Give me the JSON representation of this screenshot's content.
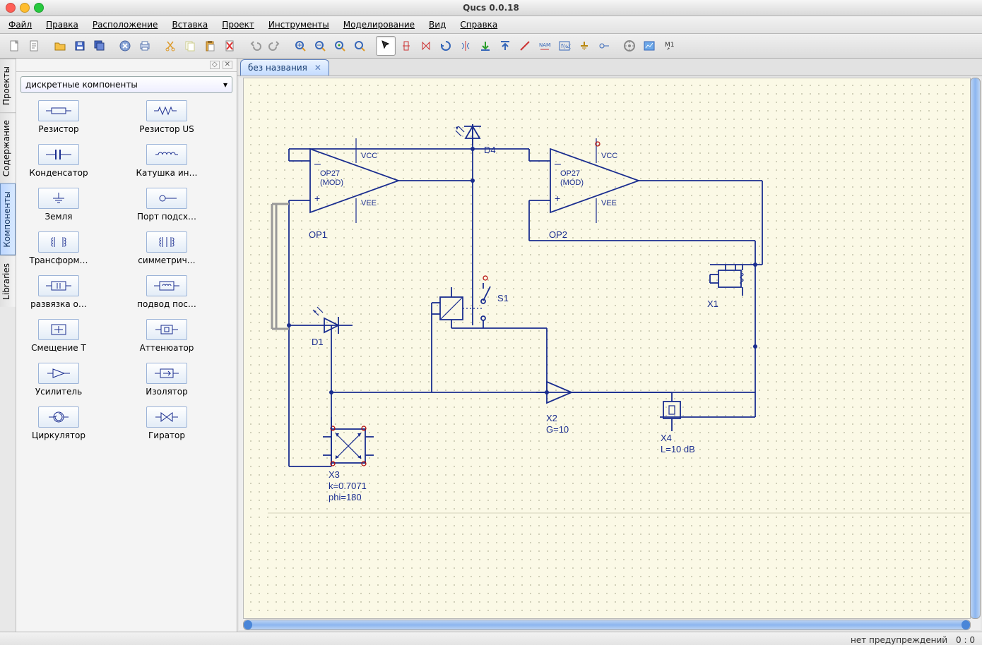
{
  "title": "Qucs 0.0.18",
  "menus": [
    "Файл",
    "Правка",
    "Расположение",
    "Вставка",
    "Проект",
    "Инструменты",
    "Моделирование",
    "Вид",
    "Справка"
  ],
  "side_tabs": [
    "Проекты",
    "Содержание",
    "Компоненты",
    "Libraries"
  ],
  "combo": "дискретные компоненты",
  "palette": [
    {
      "label": "Резистор",
      "icon": "resistor"
    },
    {
      "label": "Резистор US",
      "icon": "resistor-us"
    },
    {
      "label": "Конденсатор",
      "icon": "capacitor"
    },
    {
      "label": "Катушка ин…",
      "icon": "inductor"
    },
    {
      "label": "Земля",
      "icon": "ground"
    },
    {
      "label": "Порт подсх…",
      "icon": "port"
    },
    {
      "label": "Трансформ…",
      "icon": "transformer"
    },
    {
      "label": "симметрич…",
      "icon": "sym-transformer"
    },
    {
      "label": "развязка о…",
      "icon": "dc-block"
    },
    {
      "label": "подвод пос…",
      "icon": "dc-feed"
    },
    {
      "label": "Смещение T",
      "icon": "bias-t"
    },
    {
      "label": "Аттенюатор",
      "icon": "attenuator"
    },
    {
      "label": "Усилитель",
      "icon": "amplifier"
    },
    {
      "label": "Изолятор",
      "icon": "isolator"
    },
    {
      "label": "Циркулятор",
      "icon": "circulator"
    },
    {
      "label": "Гиратор",
      "icon": "gyrator"
    }
  ],
  "doc_tab": "без названия",
  "schematic": {
    "op1": {
      "name": "OP1",
      "text1": "OP27",
      "text2": "(MOD)",
      "vcc": "VCC",
      "vee": "VEE"
    },
    "op2": {
      "name": "OP2",
      "text1": "OP27",
      "text2": "(MOD)",
      "vcc": "VCC",
      "vee": "VEE"
    },
    "d1": "D1",
    "d4": "D4",
    "s1": "S1",
    "x1": "X1",
    "x2": {
      "name": "X2",
      "g": "G=10"
    },
    "x3": {
      "name": "X3",
      "k": "k=0.7071",
      "phi": "phi=180"
    },
    "x4": {
      "name": "X4",
      "l": "L=10 dB"
    }
  },
  "status": {
    "warn": "нет предупреждений",
    "cursor": "0 : 0"
  }
}
